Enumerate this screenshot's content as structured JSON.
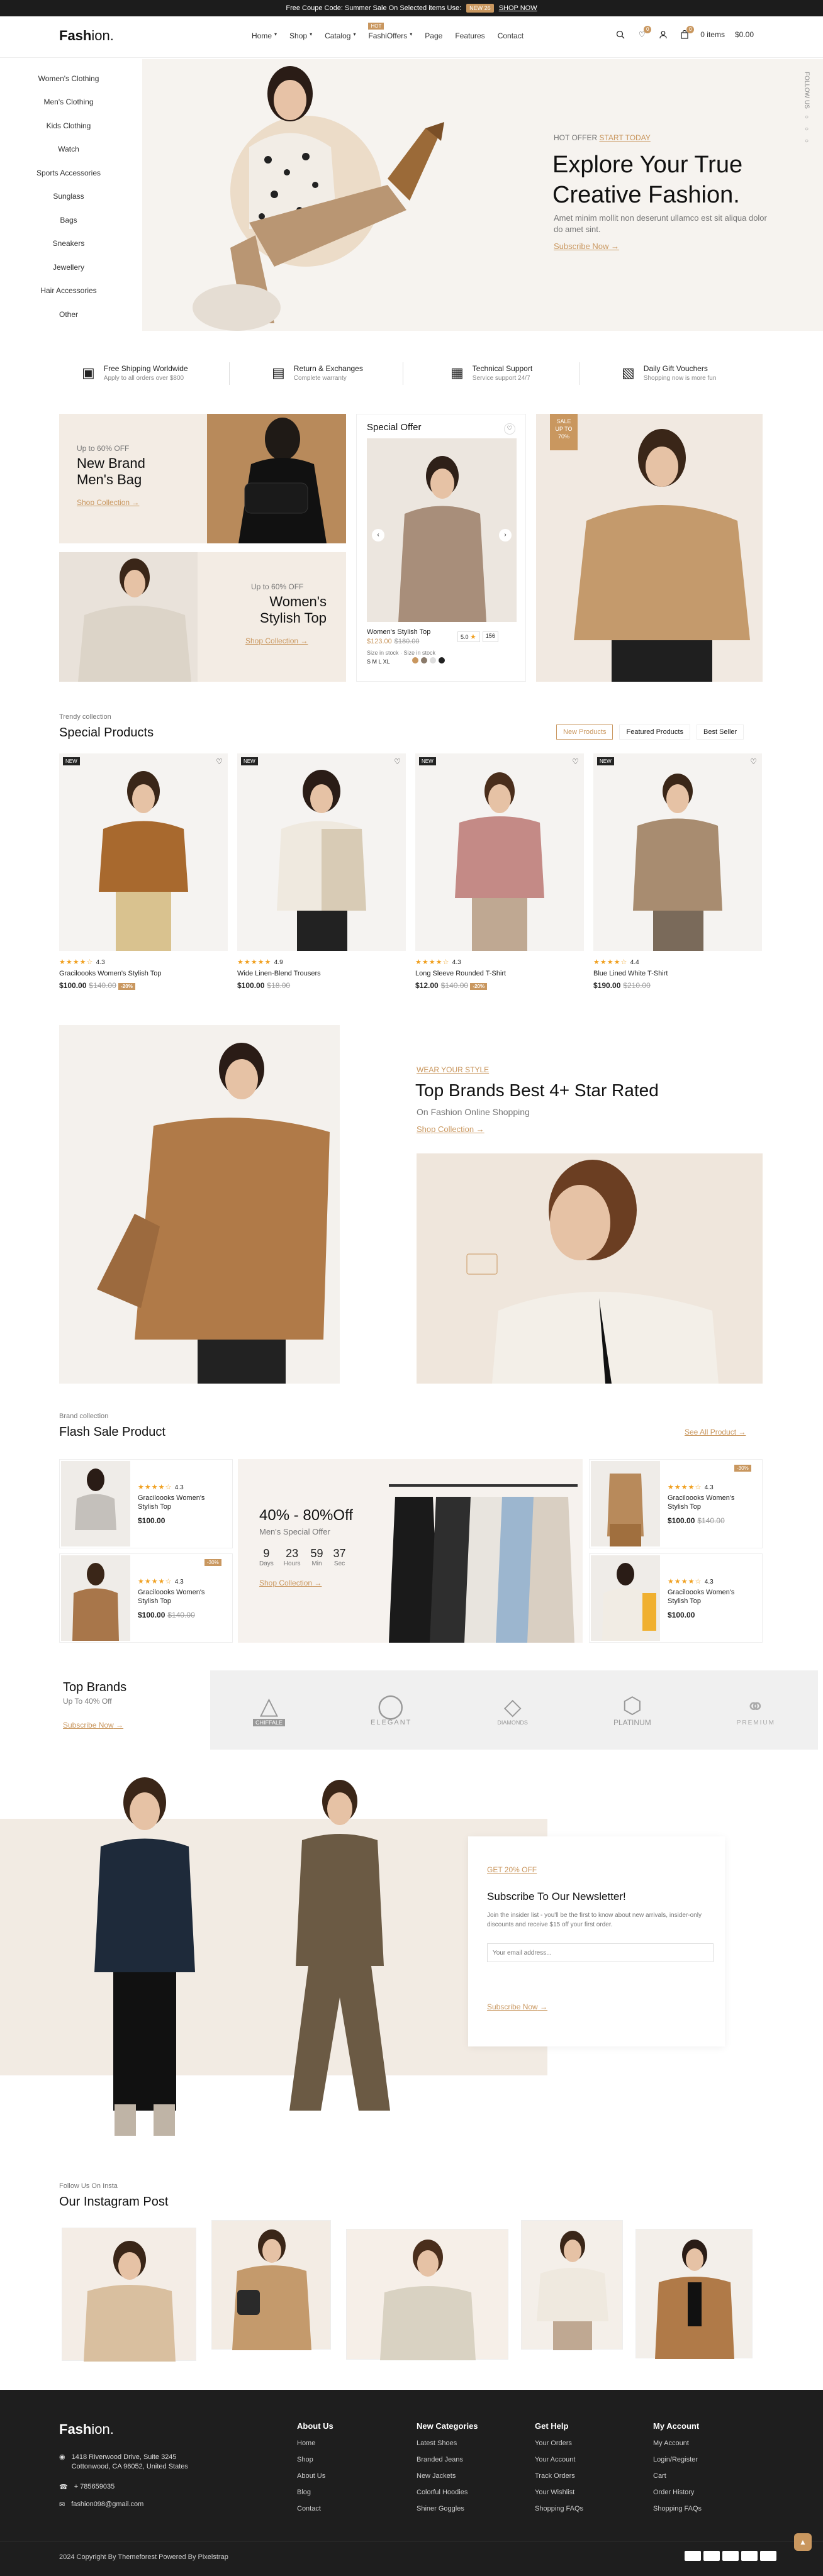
{
  "topbar": {
    "text": "Free Coupe Code: Summer Sale On Selected items Use:",
    "code": "NEW 26",
    "link": "SHOP NOW"
  },
  "header": {
    "logo_main": "Fash",
    "logo_tail": "ion.",
    "nav": [
      "Home",
      "Shop",
      "Catalog",
      "FashiOffers",
      "Page",
      "Features",
      "Contact"
    ],
    "nav_hot": "HOT",
    "cart_text": "0 items",
    "cart_total": "$0.00",
    "wishlist_count": "0",
    "cart_count": "0"
  },
  "categories": [
    "Women's Clothing",
    "Men's Clothing",
    "Kids Clothing",
    "Watch",
    "Sports Accessories",
    "Sunglass",
    "Bags",
    "Sneakers",
    "Jewellery",
    "Hair Accessories",
    "Other"
  ],
  "hero": {
    "eyebrow": "HOT OFFER",
    "eyebrow_link": "START TODAY",
    "title1": "Explore Your True",
    "title2": "Creative Fashion.",
    "desc": "Amet minim mollit non deserunt ullamco est sit aliqua dolor do amet sint.",
    "cta": "Subscribe Now",
    "follow": "FOLLOW US"
  },
  "services": [
    {
      "title": "Free Shipping Worldwide",
      "sub": "Apply to all orders over $800"
    },
    {
      "title": "Return & Exchanges",
      "sub": "Complete warranty"
    },
    {
      "title": "Technical Support",
      "sub": "Service support 24/7"
    },
    {
      "title": "Daily Gift Vouchers",
      "sub": "Shopping now is more fun"
    }
  ],
  "promo": {
    "men_off": "Up to 60% OFF",
    "men_title1": "New Brand",
    "men_title2": "Men's Bag",
    "men_cta": "Shop Collection",
    "women_off": "Up to 60% OFF",
    "women_title1": "Women's",
    "women_title2": "Stylish Top",
    "women_cta": "Shop Collection",
    "special_title": "Special Offer",
    "special_name": "Women's Stylish Top",
    "special_price": "$123.00",
    "special_old": "$180.00",
    "special_rating": "5.0",
    "special_reviews": "156",
    "special_size_label": "Size in stock",
    "special_stock_label": "Size in stock",
    "special_sizes": "S M L XL",
    "sale_badge1": "SALE",
    "sale_badge2": "UP TO",
    "sale_badge3": "70%"
  },
  "special": {
    "eyebrow": "Trendy collection",
    "title": "Special Products",
    "tabs": [
      "New Products",
      "Featured Products",
      "Best Seller"
    ],
    "products": [
      {
        "badge": "NEW",
        "rating": "4.3",
        "name": "Graciloooks Women's Stylish Top",
        "price": "$100.00",
        "old": "$140.00",
        "tag": "-20%"
      },
      {
        "badge": "NEW",
        "rating": "4.9",
        "name": "Wide Linen-Blend Trousers",
        "price": "$100.00",
        "old": "$18.00",
        "tag": ""
      },
      {
        "badge": "NEW",
        "rating": "4.3",
        "name": "Long Sleeve Rounded T-Shirt",
        "price": "$12.00",
        "old": "$140.00",
        "tag": "-20%"
      },
      {
        "badge": "NEW",
        "rating": "4.4",
        "name": "Blue Lined White T-Shirt",
        "price": "$190.00",
        "old": "$210.00",
        "tag": ""
      }
    ]
  },
  "brands_feature": {
    "eyebrow": "WEAR YOUR STYLE",
    "title": "Top Brands Best 4+ Star Rated",
    "sub": "On Fashion Online Shopping",
    "cta": "Shop Collection"
  },
  "flash": {
    "eyebrow": "Brand collection",
    "title": "Flash Sale Product",
    "see_all": "See All Product",
    "discount": "40% - 80%Off",
    "special": "Men's Special Offer",
    "timer": [
      {
        "v": "9",
        "l": "Days"
      },
      {
        "v": "23",
        "l": "Hours"
      },
      {
        "v": "59",
        "l": "Min"
      },
      {
        "v": "37",
        "l": "Sec"
      }
    ],
    "cta": "Shop Collection",
    "items": [
      {
        "rating": "4.3",
        "name": "Graciloooks Women's Stylish Top",
        "price": "$100.00",
        "old": "",
        "tag": ""
      },
      {
        "rating": "4.3",
        "name": "Graciloooks Women's Stylish Top",
        "price": "$100.00",
        "old": "$140.00",
        "tag": "-30%"
      },
      {
        "rating": "4.3",
        "name": "Graciloooks Women's Stylish Top",
        "price": "$100.00",
        "old": "$140.00",
        "tag": "-30%"
      },
      {
        "rating": "4.3",
        "name": "Graciloooks Women's Stylish Top",
        "price": "$100.00",
        "old": "",
        "tag": ""
      }
    ]
  },
  "top_brands": {
    "title": "Top Brands",
    "sub": "Up To 40% Off",
    "cta": "Subscribe Now",
    "logos": [
      "CHIFFALE",
      "ELEGANT",
      "DIAMONDS",
      "PLATINUM",
      "PREMIUM"
    ]
  },
  "newsletter": {
    "eyebrow": "GET 20% OFF",
    "title": "Subscribe To Our Newsletter!",
    "desc": "Join the insider list - you'll be the first to know about new arrivals, insider-only discounts and receive $15 off your first order.",
    "placeholder": "Your email address...",
    "cta": "Subscribe Now"
  },
  "instagram": {
    "eyebrow": "Follow Us On Insta",
    "title": "Our Instagram Post"
  },
  "footer": {
    "logo_main": "Fash",
    "logo_tail": "ion.",
    "address1": "1418 Riverwood Drive, Suite 3245",
    "address2": "Cottonwood, CA 96052, United States",
    "phone": "+ 785659035",
    "email": "fashion098@gmail.com",
    "cols": [
      {
        "title": "About Us",
        "items": [
          "Home",
          "Shop",
          "About Us",
          "Blog",
          "Contact"
        ]
      },
      {
        "title": "New Categories",
        "items": [
          "Latest Shoes",
          "Branded Jeans",
          "New Jackets",
          "Colorful Hoodies",
          "Shiner Goggles"
        ]
      },
      {
        "title": "Get Help",
        "items": [
          "Your Orders",
          "Your Account",
          "Track Orders",
          "Your Wishlist",
          "Shopping FAQs"
        ]
      },
      {
        "title": "My Account",
        "items": [
          "My Account",
          "Login/Register",
          "Cart",
          "Order History",
          "Shopping FAQs"
        ]
      }
    ],
    "copyright": "2024 Copyright By Themeforest Powered By Pixelstrap"
  },
  "colors": {
    "accent": "#c9975f",
    "dark": "#1e1e1e",
    "beige": "#efe4d6"
  }
}
